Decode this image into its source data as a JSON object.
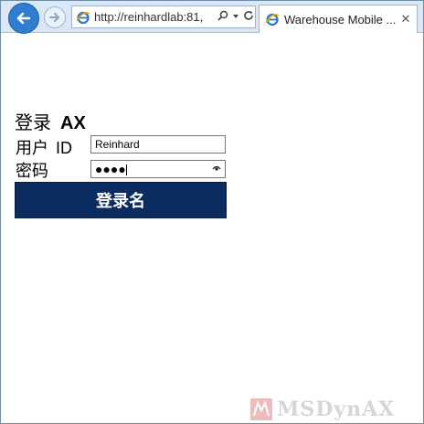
{
  "browser": {
    "address_url": "http://reinhardlab:81,",
    "search_icon": "search-icon",
    "dropdown_icon": "chevron-down-icon",
    "refresh_icon": "refresh-icon",
    "tab_title": "Warehouse Mobile ...",
    "close_glyph": "✕",
    "back_icon": "arrow-left-icon",
    "forward_icon": "arrow-right-icon",
    "accent": "#2f7fd1"
  },
  "login": {
    "heading": "登录",
    "heading_ax": "AX",
    "user_label": "用户",
    "user_label_id": "ID",
    "user_value": "Reinhard",
    "password_label": "密码",
    "password_mask": "●●●●",
    "submit_label": "登录名",
    "button_color": "#0b2c5f"
  },
  "watermark": {
    "text": "MSDynAX"
  }
}
